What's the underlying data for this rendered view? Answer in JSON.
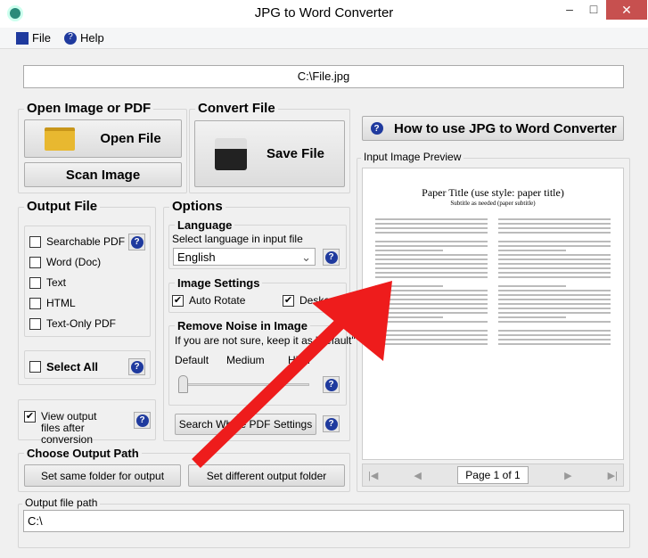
{
  "window": {
    "title": "JPG to Word Converter",
    "close": "✕",
    "minimize": "–",
    "maximize": "□"
  },
  "menu": {
    "file": "File",
    "help": "Help"
  },
  "input_path": "C:\\File.jpg",
  "open_group": {
    "title": "Open Image or PDF",
    "open_file": "Open File",
    "scan_image": "Scan Image"
  },
  "convert_group": {
    "title": "Convert File",
    "save_file": "Save File"
  },
  "how_to": "How to use JPG to Word Converter",
  "preview": {
    "title": "Input Image Preview",
    "doc_title": "Paper Title (use style: paper title)",
    "doc_subtitle": "Subtitle as needed (paper subtitle)",
    "page_label": "Page 1 of 1"
  },
  "output_file": {
    "title": "Output File",
    "items": [
      {
        "label": "Searchable PDF",
        "checked": false
      },
      {
        "label": "Word (Doc)",
        "checked": false
      },
      {
        "label": "Text",
        "checked": false
      },
      {
        "label": "HTML",
        "checked": false
      },
      {
        "label": "Text-Only PDF",
        "checked": false
      }
    ],
    "select_all": "Select All",
    "view_output": "View output files after conversion",
    "view_output_checked": true
  },
  "options": {
    "title": "Options",
    "language_title": "Language",
    "language_hint": "Select language in input file",
    "language_value": "English",
    "image_settings_title": "Image Settings",
    "auto_rotate": "Auto Rotate",
    "deskew": "Deskew",
    "noise_title": "Remove Noise in Image",
    "noise_hint": "If you are not sure, keep it as \"default\"",
    "noise_levels": [
      "Default",
      "Medium",
      "High"
    ],
    "noise_value": "Default",
    "search_pdf_settings": "Search Whole PDF Settings"
  },
  "output_path": {
    "title": "Choose Output Path",
    "same_folder": "Set same folder for output",
    "different_folder": "Set different output folder",
    "path_title": "Output file path",
    "path_value": "C:\\"
  },
  "colors": {
    "accent": "#1f3a9e",
    "arrow": "#ee1c1c",
    "close": "#c7504f"
  }
}
